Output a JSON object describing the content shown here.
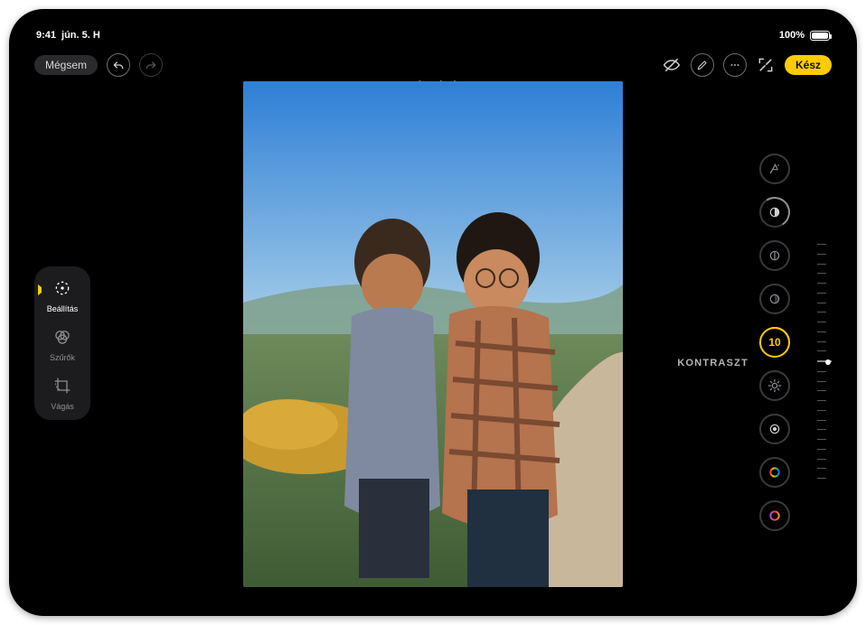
{
  "status": {
    "time": "9:41",
    "date": "jún. 5. H",
    "battery_pct": "100%"
  },
  "topbar": {
    "cancel": "Mégsem",
    "done": "Kész",
    "photo_mode_label": "BEÁLLÍTÁS"
  },
  "modes": {
    "adjust": "Beállítás",
    "filters": "Szűrők",
    "crop": "Vágás"
  },
  "adjust": {
    "selected_label": "KONTRASZT",
    "selected_value": "10",
    "tools": [
      {
        "name": "auto",
        "icon": "wand",
        "modified": false
      },
      {
        "name": "exposure",
        "icon": "yin",
        "modified": true
      },
      {
        "name": "brilliance",
        "icon": "half",
        "modified": false
      },
      {
        "name": "highlights",
        "icon": "half",
        "modified": false
      },
      {
        "name": "contrast",
        "icon": "value",
        "selected": true
      },
      {
        "name": "brightness",
        "icon": "sun",
        "modified": false
      },
      {
        "name": "black-point",
        "icon": "dot",
        "modified": false
      },
      {
        "name": "saturation",
        "icon": "hue",
        "modified": false
      },
      {
        "name": "vibrance",
        "icon": "hue",
        "modified": false
      }
    ]
  }
}
